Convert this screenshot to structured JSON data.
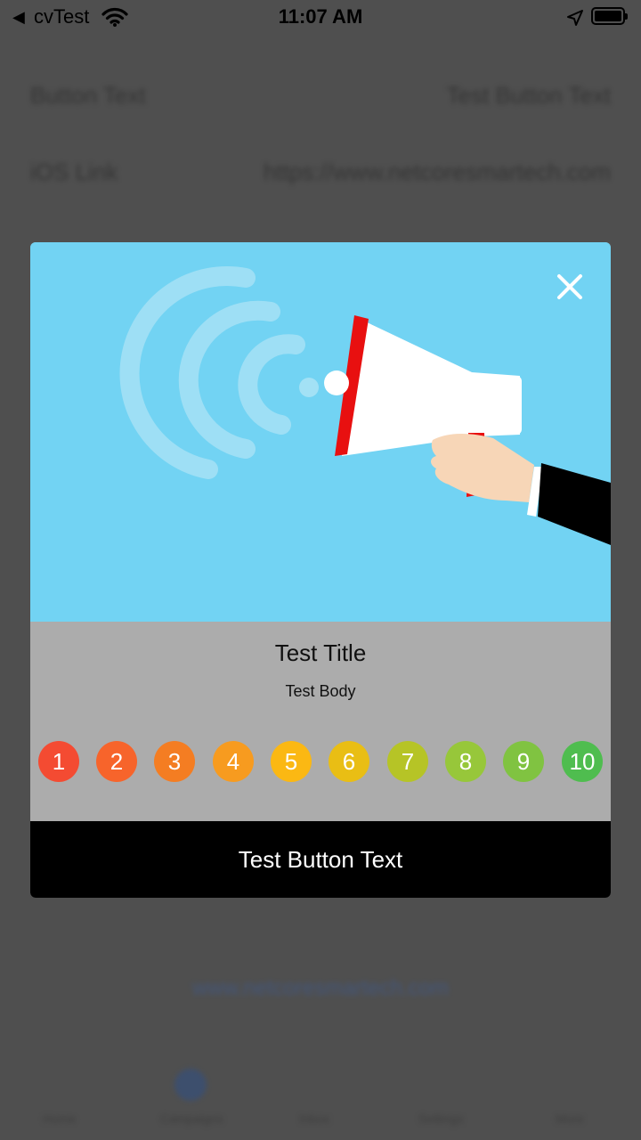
{
  "status_bar": {
    "back_arrow": "◀",
    "app_name": "cvTest",
    "time": "11:07 AM",
    "icons": [
      "wifi-icon",
      "location-icon",
      "battery-icon"
    ]
  },
  "background_page": {
    "rows": [
      {
        "label": "Button Text",
        "value": "Test Button Text"
      },
      {
        "label": "iOS Link",
        "value": "https://www.netcoresmartech.com"
      }
    ],
    "link_text": "www.netcoresmartech.com",
    "tabs": [
      "Home",
      "Campaigns",
      "Inbox",
      "Settings",
      "More"
    ]
  },
  "modal": {
    "hero_image": "megaphone-illustration",
    "close_icon": "×",
    "title": "Test Title",
    "body": "Test Body",
    "rating": {
      "values": [
        "1",
        "2",
        "3",
        "4",
        "5",
        "6",
        "7",
        "8",
        "9",
        "10"
      ],
      "colors": [
        "#f44b32",
        "#f7642b",
        "#f47d22",
        "#f79b1f",
        "#fbb813",
        "#e9be14",
        "#b6c426",
        "#97c73a",
        "#80c341",
        "#4fbd4f"
      ]
    },
    "button_text": "Test Button Text",
    "colors": {
      "hero_bg": "#72d3f3",
      "panel_bg": "#acacac",
      "button_bg": "#000000"
    }
  }
}
